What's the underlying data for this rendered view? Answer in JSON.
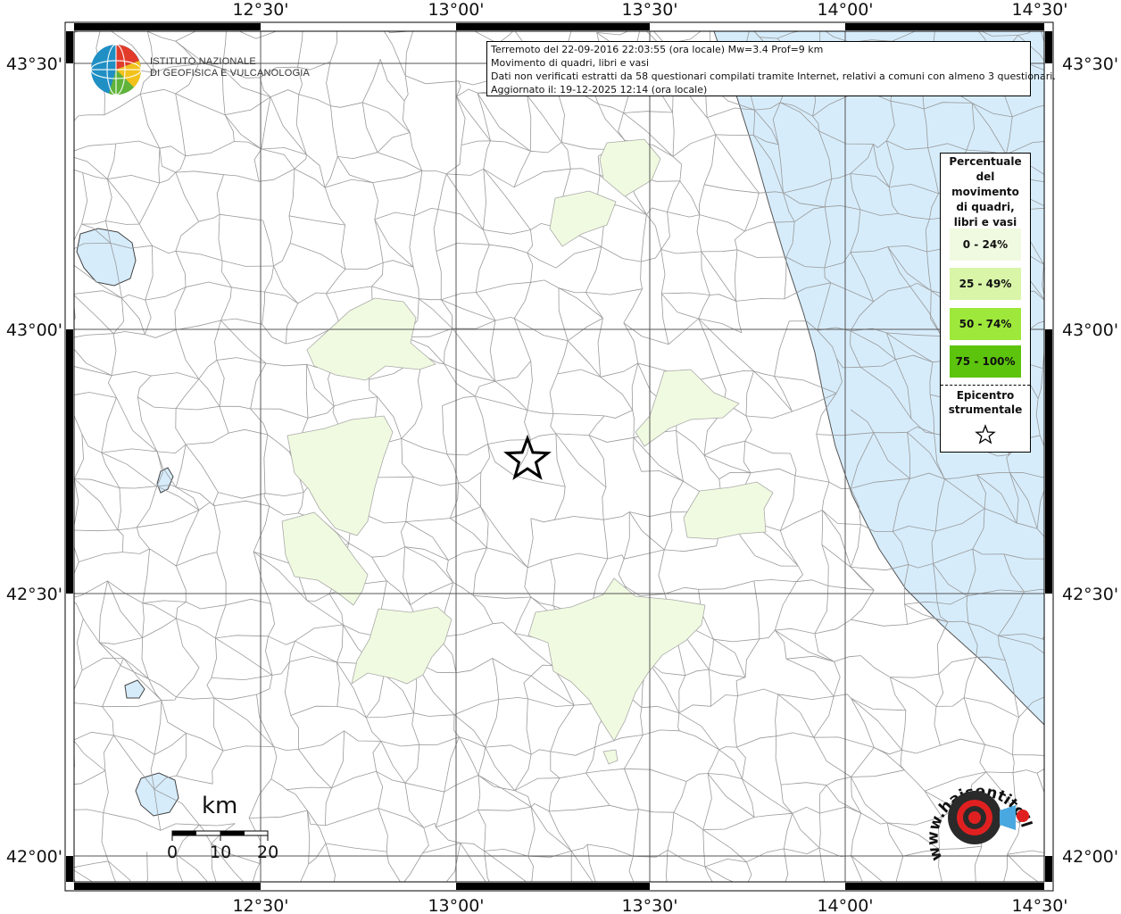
{
  "map": {
    "lon_labels": [
      "12°30'",
      "13°00'",
      "13°30'",
      "14°00'",
      "14°30'"
    ],
    "lat_labels": [
      "43°30'",
      "43°00'",
      "42°30'",
      "42°00'"
    ],
    "epicenter": {
      "label": "Epicentro strumentale"
    }
  },
  "info": {
    "line1": "Terremoto del 22-09-2016 22:03:55 (ora locale) Mw=3.4 Prof=9 km",
    "line2": "Movimento di quadri, libri e vasi",
    "line3": "Dati non verificati estratti da 58 questionari compilati tramite Internet, relativi a comuni con almeno 3 questionari.",
    "line4": "Aggiornato il: 19-12-2025 12:14 (ora locale)"
  },
  "legend": {
    "title": "Percentuale del movimento di quadri, libri e vasi",
    "title_lines": [
      "Percentuale",
      "del",
      "movimento",
      "di quadri,",
      "libri e vasi"
    ],
    "items": [
      {
        "label": "0 - 24%",
        "color": "#f0fae0"
      },
      {
        "label": "25 - 49%",
        "color": "#d8f5a8"
      },
      {
        "label": "50 - 74%",
        "color": "#9ee83c"
      },
      {
        "label": "75 - 100%",
        "color": "#5cc40c"
      }
    ],
    "epicenter_lines": [
      "Epicentro",
      "strumentale"
    ]
  },
  "logos": {
    "ingv_line1": "ISTITUTO NAZIONALE",
    "ingv_line2": "DI GEOFISICA E VULCANOLOGIA",
    "hst_text": "www.haisentitoilterremoto.it"
  },
  "scale": {
    "unit": "km",
    "ticks": [
      "0",
      "10",
      "20"
    ]
  },
  "colors": {
    "sea": "#d6ecfb",
    "municipality_fill": "#f0fae0",
    "border_line": "#999999",
    "grid": "#555555"
  }
}
